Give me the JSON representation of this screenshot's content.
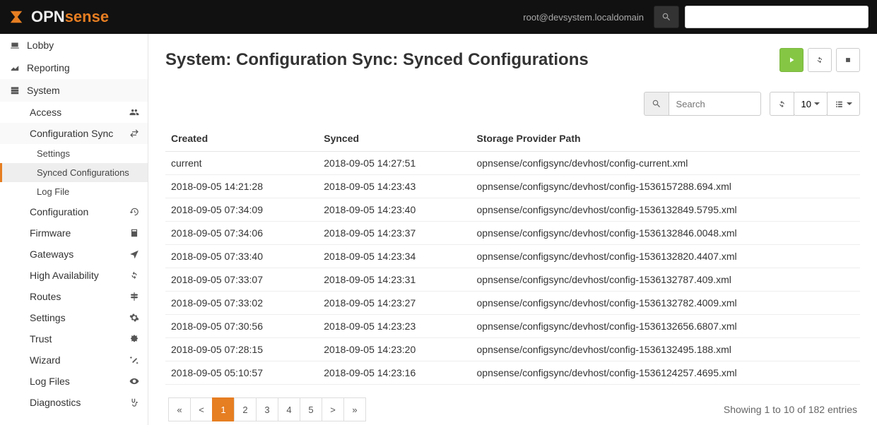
{
  "topbar": {
    "user": "root@devsystem.localdomain",
    "logo_first": "OPN",
    "logo_second": "sense"
  },
  "sidebar": {
    "top": [
      {
        "label": "Lobby"
      },
      {
        "label": "Reporting"
      },
      {
        "label": "System"
      }
    ],
    "system": [
      {
        "label": "Access"
      },
      {
        "label": "Configuration Sync"
      },
      {
        "label": "Configuration"
      },
      {
        "label": "Firmware"
      },
      {
        "label": "Gateways"
      },
      {
        "label": "High Availability"
      },
      {
        "label": "Routes"
      },
      {
        "label": "Settings"
      },
      {
        "label": "Trust"
      },
      {
        "label": "Wizard"
      },
      {
        "label": "Log Files"
      },
      {
        "label": "Diagnostics"
      }
    ],
    "configsync": [
      {
        "label": "Settings"
      },
      {
        "label": "Synced Configurations"
      },
      {
        "label": "Log File"
      }
    ]
  },
  "page": {
    "title": "System: Configuration Sync: Synced Configurations"
  },
  "toolbar": {
    "search_placeholder": "Search",
    "page_size": "10"
  },
  "table": {
    "columns": [
      "Created",
      "Synced",
      "Storage Provider Path"
    ],
    "rows": [
      {
        "created": "current",
        "synced": "2018-09-05 14:27:51",
        "path": "opnsense/configsync/devhost/config-current.xml"
      },
      {
        "created": "2018-09-05 14:21:28",
        "synced": "2018-09-05 14:23:43",
        "path": "opnsense/configsync/devhost/config-1536157288.694.xml"
      },
      {
        "created": "2018-09-05 07:34:09",
        "synced": "2018-09-05 14:23:40",
        "path": "opnsense/configsync/devhost/config-1536132849.5795.xml"
      },
      {
        "created": "2018-09-05 07:34:06",
        "synced": "2018-09-05 14:23:37",
        "path": "opnsense/configsync/devhost/config-1536132846.0048.xml"
      },
      {
        "created": "2018-09-05 07:33:40",
        "synced": "2018-09-05 14:23:34",
        "path": "opnsense/configsync/devhost/config-1536132820.4407.xml"
      },
      {
        "created": "2018-09-05 07:33:07",
        "synced": "2018-09-05 14:23:31",
        "path": "opnsense/configsync/devhost/config-1536132787.409.xml"
      },
      {
        "created": "2018-09-05 07:33:02",
        "synced": "2018-09-05 14:23:27",
        "path": "opnsense/configsync/devhost/config-1536132782.4009.xml"
      },
      {
        "created": "2018-09-05 07:30:56",
        "synced": "2018-09-05 14:23:23",
        "path": "opnsense/configsync/devhost/config-1536132656.6807.xml"
      },
      {
        "created": "2018-09-05 07:28:15",
        "synced": "2018-09-05 14:23:20",
        "path": "opnsense/configsync/devhost/config-1536132495.188.xml"
      },
      {
        "created": "2018-09-05 05:10:57",
        "synced": "2018-09-05 14:23:16",
        "path": "opnsense/configsync/devhost/config-1536124257.4695.xml"
      }
    ]
  },
  "pagination": {
    "buttons": [
      "«",
      "<",
      "1",
      "2",
      "3",
      "4",
      "5",
      ">",
      "»"
    ],
    "active_index": 2,
    "summary": "Showing 1 to 10 of 182 entries"
  }
}
